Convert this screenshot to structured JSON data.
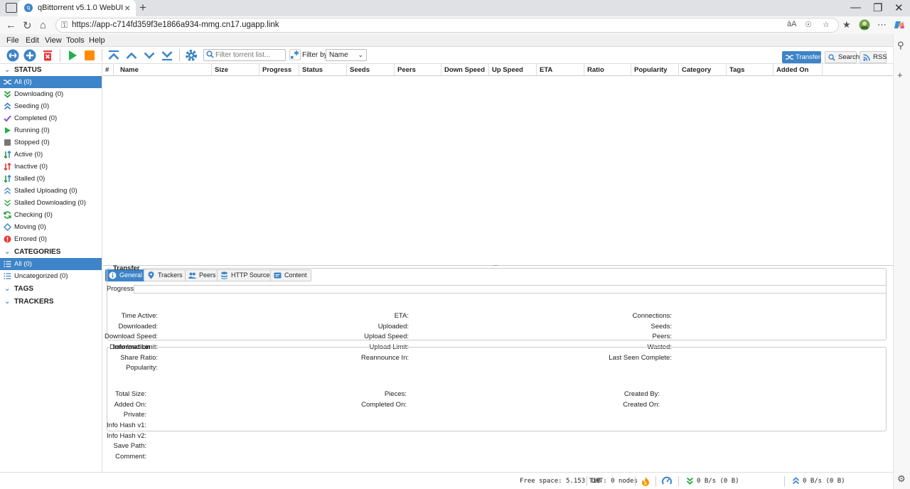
{
  "browser": {
    "tab_title": "qBittorrent v5.1.0 WebUI",
    "url": "https://app-c714fd359f3e1866a934-mmg.cn17.ugapp.link",
    "new_tab": "+",
    "tab_close": "×",
    "reader_mode": "āA"
  },
  "menu": [
    "File",
    "Edit",
    "View",
    "Tools",
    "Help"
  ],
  "toolbar": {
    "filter_placeholder": "Filter torrent list...",
    "filter_by_label": "Filter by:",
    "filter_by_value": "Name",
    "views": [
      "Transfers",
      "Search",
      "RSS"
    ],
    "colors": {
      "accent": "#3d84c8",
      "play": "#22b14c",
      "stop": "#ff8c00",
      "delete": "#e53935"
    }
  },
  "sidebar": {
    "status_header": "STATUS",
    "status_items": [
      {
        "label": "All (0)",
        "icon": "all-icon"
      },
      {
        "label": "Downloading (0)",
        "icon": "downloading-icon"
      },
      {
        "label": "Seeding (0)",
        "icon": "seeding-icon"
      },
      {
        "label": "Completed (0)",
        "icon": "completed-icon"
      },
      {
        "label": "Running (0)",
        "icon": "running-icon"
      },
      {
        "label": "Stopped (0)",
        "icon": "stopped-icon"
      },
      {
        "label": "Active (0)",
        "icon": "active-icon"
      },
      {
        "label": "Inactive (0)",
        "icon": "inactive-icon"
      },
      {
        "label": "Stalled (0)",
        "icon": "stalled-icon"
      },
      {
        "label": "Stalled Uploading (0)",
        "icon": "stalled-uploading-icon"
      },
      {
        "label": "Stalled Downloading (0)",
        "icon": "stalled-downloading-icon"
      },
      {
        "label": "Checking (0)",
        "icon": "checking-icon"
      },
      {
        "label": "Moving (0)",
        "icon": "moving-icon"
      },
      {
        "label": "Errored (0)",
        "icon": "errored-icon"
      }
    ],
    "categories_header": "CATEGORIES",
    "category_items": [
      {
        "label": "All (0)"
      },
      {
        "label": "Uncategorized (0)"
      }
    ],
    "tags_header": "TAGS",
    "trackers_header": "TRACKERS"
  },
  "columns": [
    "#",
    "Name",
    "Size",
    "Progress",
    "Status",
    "Seeds",
    "Peers",
    "Down Speed",
    "Up Speed",
    "ETA",
    "Ratio",
    "Popularity",
    "Category",
    "Tags",
    "Added On"
  ],
  "details": {
    "tabs": [
      "General",
      "Trackers",
      "Peers",
      "HTTP Sources",
      "Content"
    ],
    "progress_label": "Progress:",
    "transfer_legend": "Transfer",
    "transfer_col1": [
      "Time Active:",
      "Downloaded:",
      "Download Speed:",
      "Download Limit:",
      "Share Ratio:",
      "Popularity:"
    ],
    "transfer_col2": [
      "ETA:",
      "Uploaded:",
      "Upload Speed:",
      "Upload Limit:",
      "Reannounce In:"
    ],
    "transfer_col3": [
      "Connections:",
      "Seeds:",
      "Peers:",
      "Wasted:",
      "Last Seen Complete:"
    ],
    "info_legend": "Information",
    "info_col1": [
      "Total Size:",
      "Added On:",
      "Private:",
      "Info Hash v1:",
      "Info Hash v2:",
      "Save Path:",
      "Comment:"
    ],
    "info_col2": [
      "Pieces:",
      "Completed On:"
    ],
    "info_col3": [
      "Created By:",
      "Created On:"
    ]
  },
  "status": {
    "free_space": "Free space: 5.153 TiB",
    "dht": "DHT: 0 nodes",
    "down": "0 B/s (0 B)",
    "up": "0 B/s (0 B)"
  }
}
